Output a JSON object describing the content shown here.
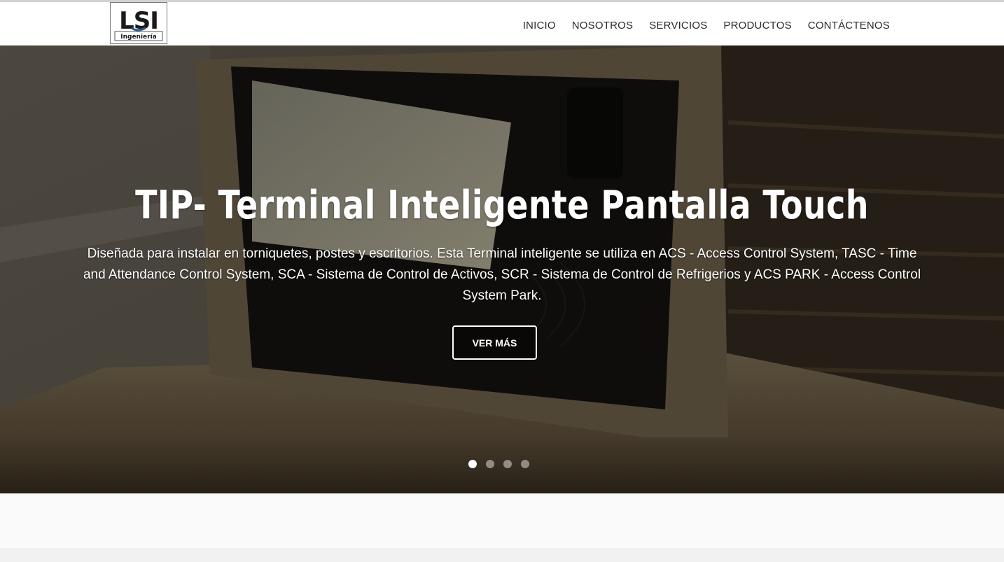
{
  "logo": {
    "top_text": "LSI",
    "sub_text": "Ingeniería"
  },
  "nav": {
    "items": [
      "INICIO",
      "NOSOTROS",
      "SERVICIOS",
      "PRODUCTOS",
      "CONTÁCTENOS"
    ]
  },
  "hero": {
    "title": "TIP- Terminal Inteligente Pantalla Touch",
    "description": "Diseñada para instalar en torniquetes, postes y escritorios. Esta Terminal inteligente se utiliza en ACS - Access Control System, TASC - Time and Attendance Control System, SCA - Sistema de Control de Activos, SCR - Sistema de Control de Refrigerios y ACS PARK - Access Control System Park.",
    "button_label": "VER MÁS",
    "slides_total": 4,
    "active_slide": 1
  },
  "colors": {
    "header_bg": "#ffffff",
    "hero_overlay": "#2b2620",
    "text_light": "#ffffff"
  }
}
